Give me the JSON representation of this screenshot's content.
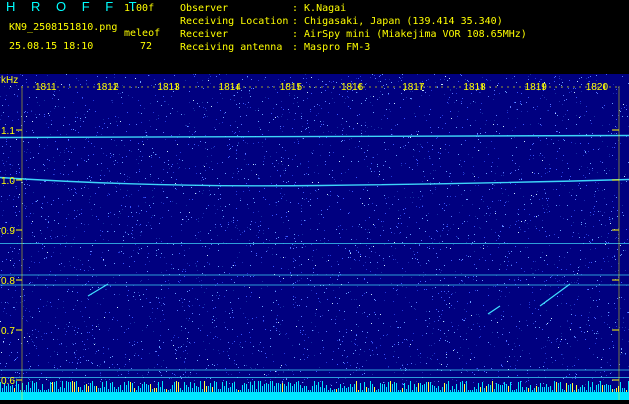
{
  "header": {
    "app_title": "H R O F F T",
    "app_version": "1.00f",
    "file_name": "KN9_2508151810.png",
    "mode_label": "meleof",
    "timestamp": "25.08.15 18:10",
    "level_value": "72",
    "meta": [
      {
        "key": "Observer",
        "value": ": K.Nagai"
      },
      {
        "key": "Receiving Location",
        "value": ": Chigasaki, Japan (139.414 35.340)"
      },
      {
        "key": "Receiver",
        "value": ": AirSpy mini (Miakejima VOR 108.65MHz)"
      },
      {
        "key": "Receiving antenna",
        "value": ": Maspro FM-3"
      }
    ]
  },
  "spectrogram": {
    "unit": "kHz",
    "time_labels": [
      "1811",
      "1812",
      "1813",
      "1814",
      "1815",
      "1816",
      "1817",
      "1818",
      "1819",
      "1820"
    ],
    "freq_labels": [
      "1.1",
      "1.0",
      "0.9",
      "0.8",
      "0.7",
      "0.6"
    ],
    "freq_values": [
      1.1,
      1.0,
      0.9,
      0.8,
      0.7,
      0.6
    ],
    "freq_range": [
      0.57,
      1.2
    ],
    "carrier_freqs": [
      1.085,
      1.005,
      0.873,
      0.81,
      0.79,
      0.62,
      0.605
    ],
    "colors": {
      "background": "#000080",
      "noise": "#2a3cff",
      "carrier": "#40e0ff",
      "baseline": "#00e5ff",
      "labels": "#ffff00"
    }
  }
}
